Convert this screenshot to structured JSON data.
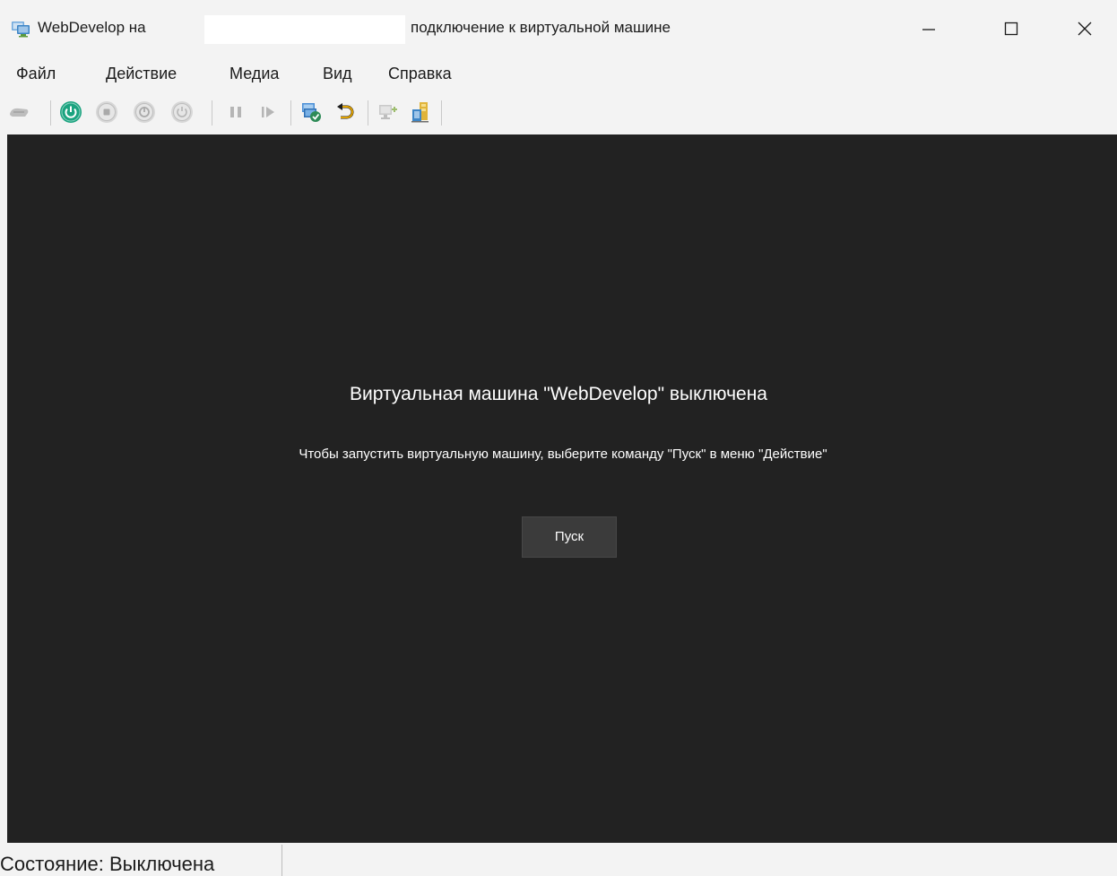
{
  "window": {
    "title_prefix": "WebDevelop на",
    "title_host": "",
    "title_suffix": "подключение к виртуальной машине",
    "app_icon": "vm-connect-icon"
  },
  "window_controls": {
    "minimize_icon": "minimize-icon",
    "maximize_icon": "maximize-icon",
    "close_icon": "close-icon"
  },
  "menu": {
    "items": [
      "Файл",
      "Действие",
      "Медиа",
      "Вид",
      "Справка"
    ]
  },
  "toolbar": {
    "buttons": [
      {
        "icon": "ctrl-alt-del-icon",
        "enabled": false
      },
      {
        "icon": "start-power-icon",
        "enabled": true,
        "color": "#1aa37f"
      },
      {
        "icon": "turn-off-icon",
        "enabled": false
      },
      {
        "icon": "shutdown-icon",
        "enabled": false
      },
      {
        "icon": "save-state-icon",
        "enabled": false
      },
      {
        "icon": "pause-icon",
        "enabled": false
      },
      {
        "icon": "resume-icon",
        "enabled": false
      },
      {
        "icon": "checkpoint-icon",
        "enabled": true
      },
      {
        "icon": "revert-icon",
        "enabled": true,
        "color": "#e0a100"
      },
      {
        "icon": "enhanced-session-icon",
        "enabled": false
      },
      {
        "icon": "share-icon",
        "enabled": true
      }
    ]
  },
  "screen": {
    "background": "#222222",
    "message_title": "Виртуальная машина \"WebDevelop\" выключена",
    "message_hint": "Чтобы запустить виртуальную машину, выберите команду \"Пуск\" в меню \"Действие\"",
    "start_button_label": "Пуск"
  },
  "status": {
    "text": "Состояние: Выключена"
  }
}
